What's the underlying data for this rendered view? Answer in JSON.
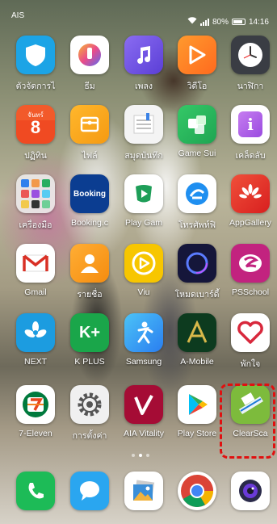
{
  "status_bar": {
    "carrier": "AIS",
    "battery": "80%",
    "time": "14:16"
  },
  "apps": [
    {
      "label": "ตัวจัดการไ",
      "icon": "shield-icon"
    },
    {
      "label": "ธีม",
      "icon": "theme-brush-icon"
    },
    {
      "label": "เพลง",
      "icon": "music-note-icon"
    },
    {
      "label": "วิดีโอ",
      "icon": "video-play-icon"
    },
    {
      "label": "นาฬิกา",
      "icon": "clock-icon"
    },
    {
      "label": "ปฏิทิน",
      "icon": "calendar-icon",
      "day_name": "จันทร์",
      "day_number": "8"
    },
    {
      "label": "ไฟล์",
      "icon": "files-folder-icon"
    },
    {
      "label": "สมุดบันทึก",
      "icon": "notepad-icon"
    },
    {
      "label": "Game Sui",
      "icon": "game-suite-icon"
    },
    {
      "label": "เคล็ดลับ",
      "icon": "tips-icon"
    },
    {
      "label": "เครื่องมือ",
      "icon": "tools-folder-icon"
    },
    {
      "label": "Booking.c",
      "icon": "booking-icon",
      "icon_text": "Booking"
    },
    {
      "label": "Play Gam",
      "icon": "play-games-icon"
    },
    {
      "label": "โทรศัพท์ฟิ",
      "icon": "phone-clone-icon"
    },
    {
      "label": "AppGallery",
      "icon": "huawei-appgallery-icon"
    },
    {
      "label": "Gmail",
      "icon": "gmail-icon"
    },
    {
      "label": "รายชื่อ",
      "icon": "contacts-icon"
    },
    {
      "label": "Viu",
      "icon": "viu-icon"
    },
    {
      "label": "โหมดเบาร์ดี้",
      "icon": "ring-icon"
    },
    {
      "label": "PSSchool",
      "icon": "psschool-icon"
    },
    {
      "label": "NEXT",
      "icon": "krungthai-next-icon"
    },
    {
      "label": "K PLUS",
      "icon": "kplus-icon",
      "icon_text": "K+"
    },
    {
      "label": "Samsung",
      "icon": "samsung-health-icon"
    },
    {
      "label": "A-Mobile",
      "icon": "a-mobile-icon"
    },
    {
      "label": "พักใจ",
      "icon": "heart-hands-icon"
    },
    {
      "label": "7-Eleven",
      "icon": "seven-eleven-icon"
    },
    {
      "label": "การตั้งค่า",
      "icon": "settings-gear-icon"
    },
    {
      "label": "AIA Vitality",
      "icon": "aia-vitality-icon"
    },
    {
      "label": "Play Store",
      "icon": "play-store-icon"
    },
    {
      "label": "ClearSca",
      "icon": "clearscanner-icon"
    }
  ],
  "dock": [
    {
      "name": "phone",
      "icon": "phone-icon"
    },
    {
      "name": "messages",
      "icon": "message-icon"
    },
    {
      "name": "gallery",
      "icon": "gallery-icon"
    },
    {
      "name": "chrome",
      "icon": "chrome-icon"
    },
    {
      "name": "camera",
      "icon": "camera-icon"
    }
  ],
  "page_indicator": {
    "pages": 3,
    "current": 2
  },
  "colors": {
    "highlight": "#e01010"
  }
}
